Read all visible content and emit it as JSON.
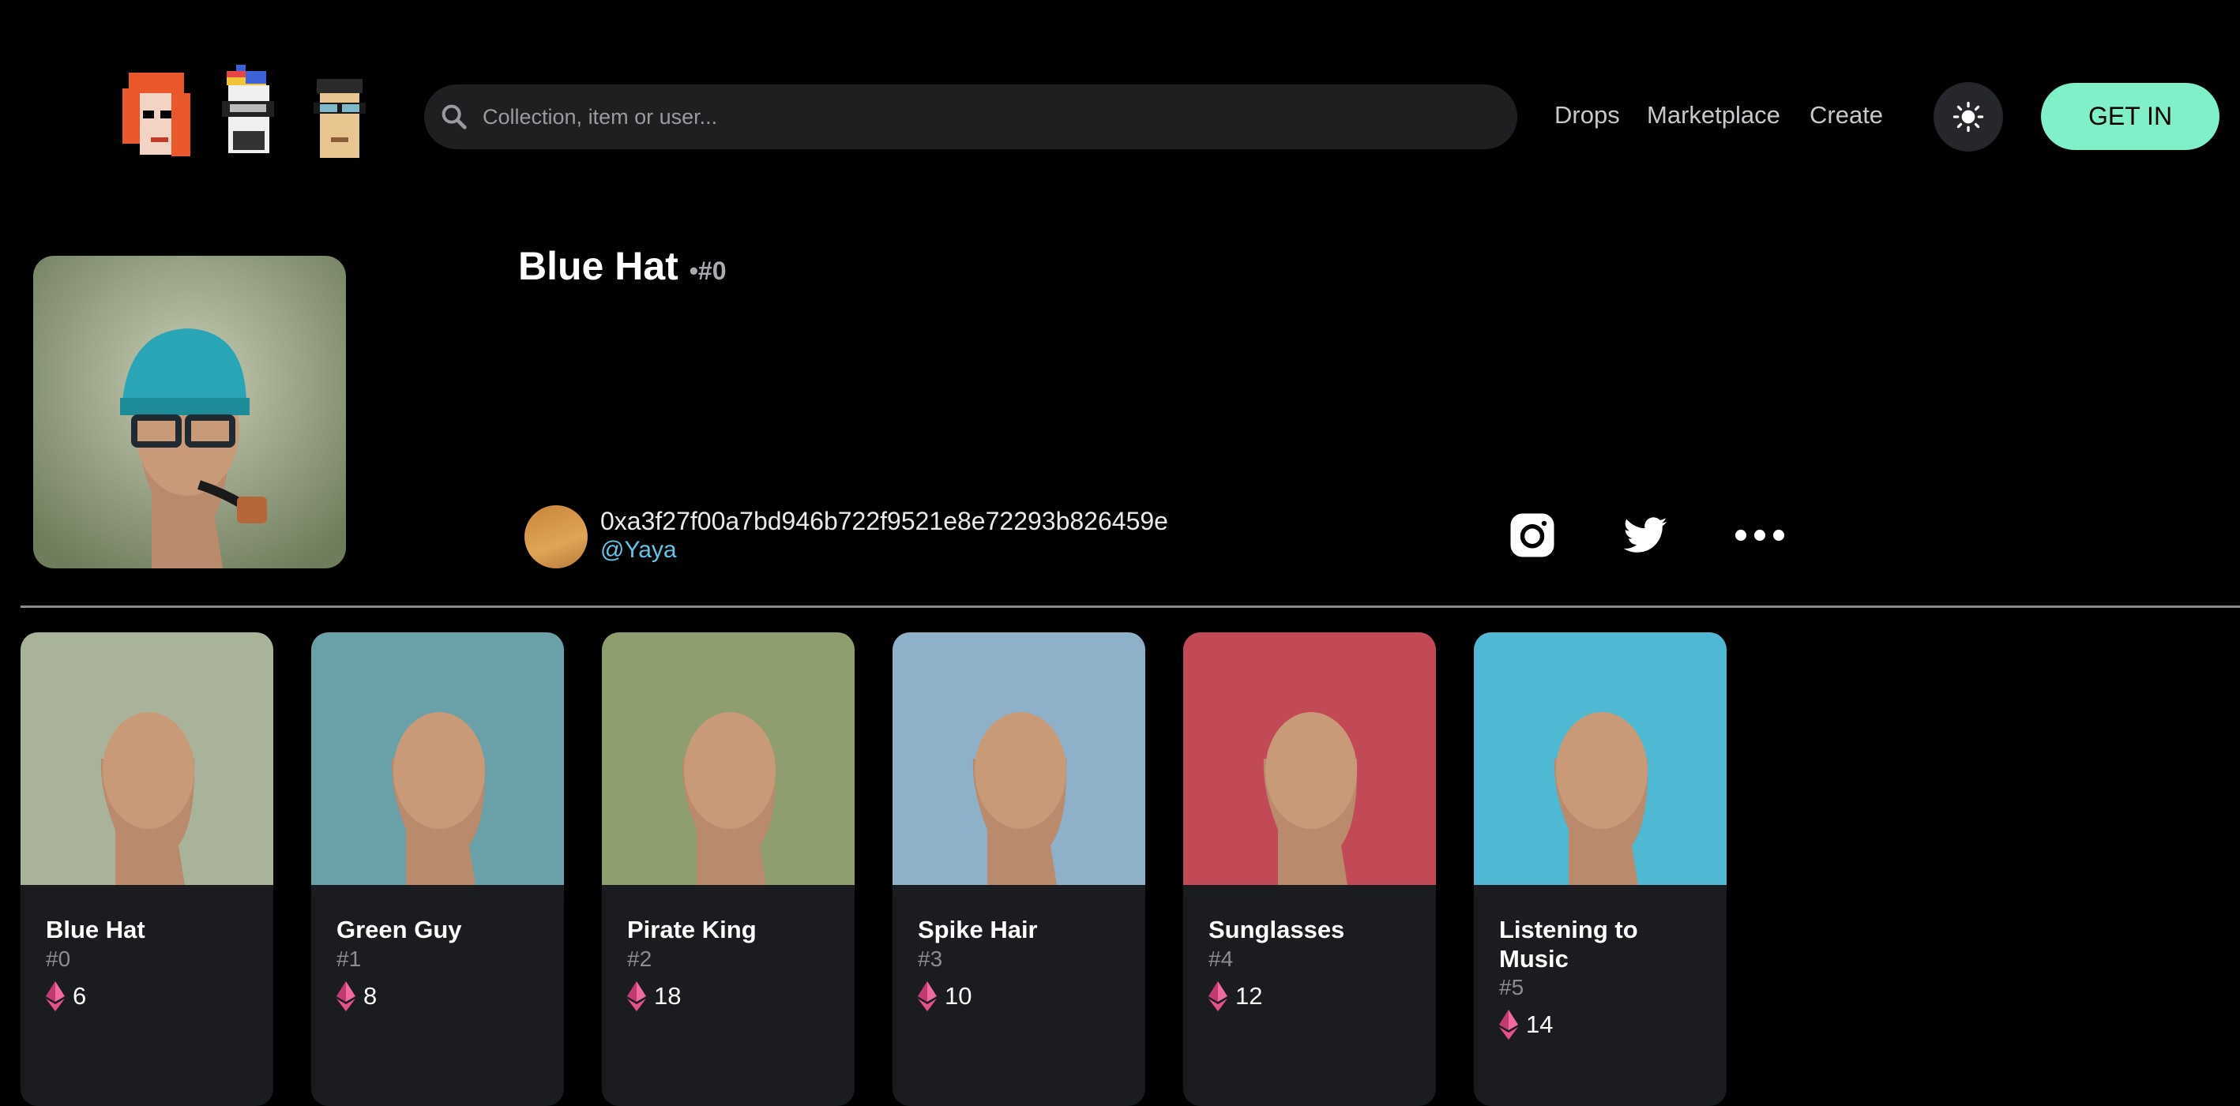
{
  "header": {
    "search_placeholder": "Collection, item or user...",
    "nav": [
      "Drops",
      "Marketplace",
      "Create"
    ],
    "cta": "GET IN",
    "logo_icons": [
      "punk-red-hair-icon",
      "punk-beanie-icon",
      "punk-sunglasses-icon"
    ]
  },
  "item": {
    "name": "Blue Hat",
    "separator": "•",
    "number": "#0",
    "owner_address": "0xa3f27f00a7bd946b722f9521e8e72293b826459e",
    "owner_handle": "@Yaya",
    "social_icons": [
      "instagram-icon",
      "twitter-icon",
      "more-icon"
    ]
  },
  "cards": [
    {
      "name": "Blue Hat",
      "number": "#0",
      "price": "6",
      "bg": "#a9b39a"
    },
    {
      "name": "Green Guy",
      "number": "#1",
      "price": "8",
      "bg": "#6aa0a8"
    },
    {
      "name": "Pirate King",
      "number": "#2",
      "price": "18",
      "bg": "#8f9e6e"
    },
    {
      "name": "Spike Hair",
      "number": "#3",
      "price": "10",
      "bg": "#8fb0c9"
    },
    {
      "name": "Sunglasses",
      "number": "#4",
      "price": "12",
      "bg": "#c24a57"
    },
    {
      "name": "Listening to Music",
      "number": "#5",
      "price": "14",
      "bg": "#4fb9d4"
    }
  ],
  "colors": {
    "accent": "#7ff0c8",
    "handle": "#5ec7e8",
    "eth": "#e8508c",
    "card_bg": "#1b1c1f"
  }
}
